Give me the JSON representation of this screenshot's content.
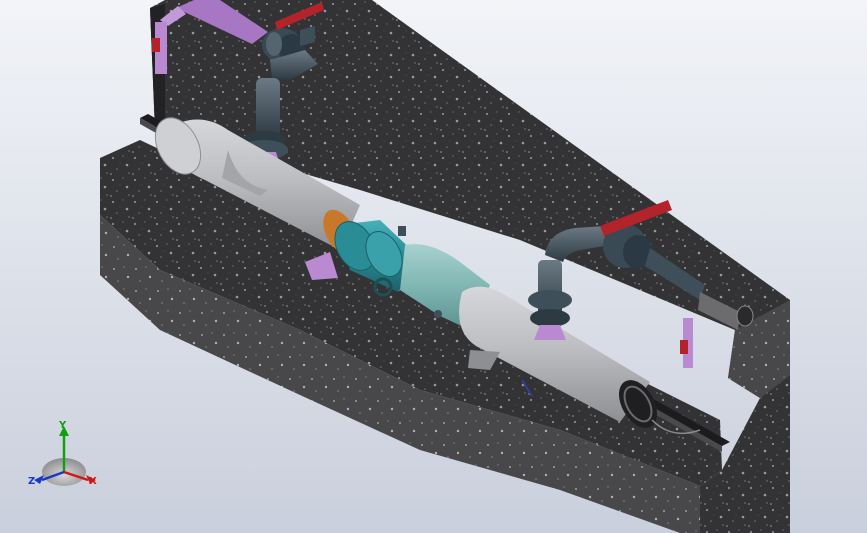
{
  "scene": {
    "colors": {
      "concrete_dark": "#2b2b2d",
      "concrete_mid": "#3c3c3e",
      "concrete_light": "#4a4a4c",
      "pipe_gray": "#b9babd",
      "pipe_teal": "#7fb6b3",
      "pump_teal": "#2a8c94",
      "flange_orange": "#c9782a",
      "valve_red": "#b3242a",
      "water_purple": "#b98ad1",
      "steel_dark": "#3e4f5a"
    }
  },
  "triad": {
    "x_label": "X",
    "y_label": "Y",
    "z_label": "Z",
    "x_color": "#d01616",
    "y_color": "#12a012",
    "z_color": "#1838c8"
  }
}
